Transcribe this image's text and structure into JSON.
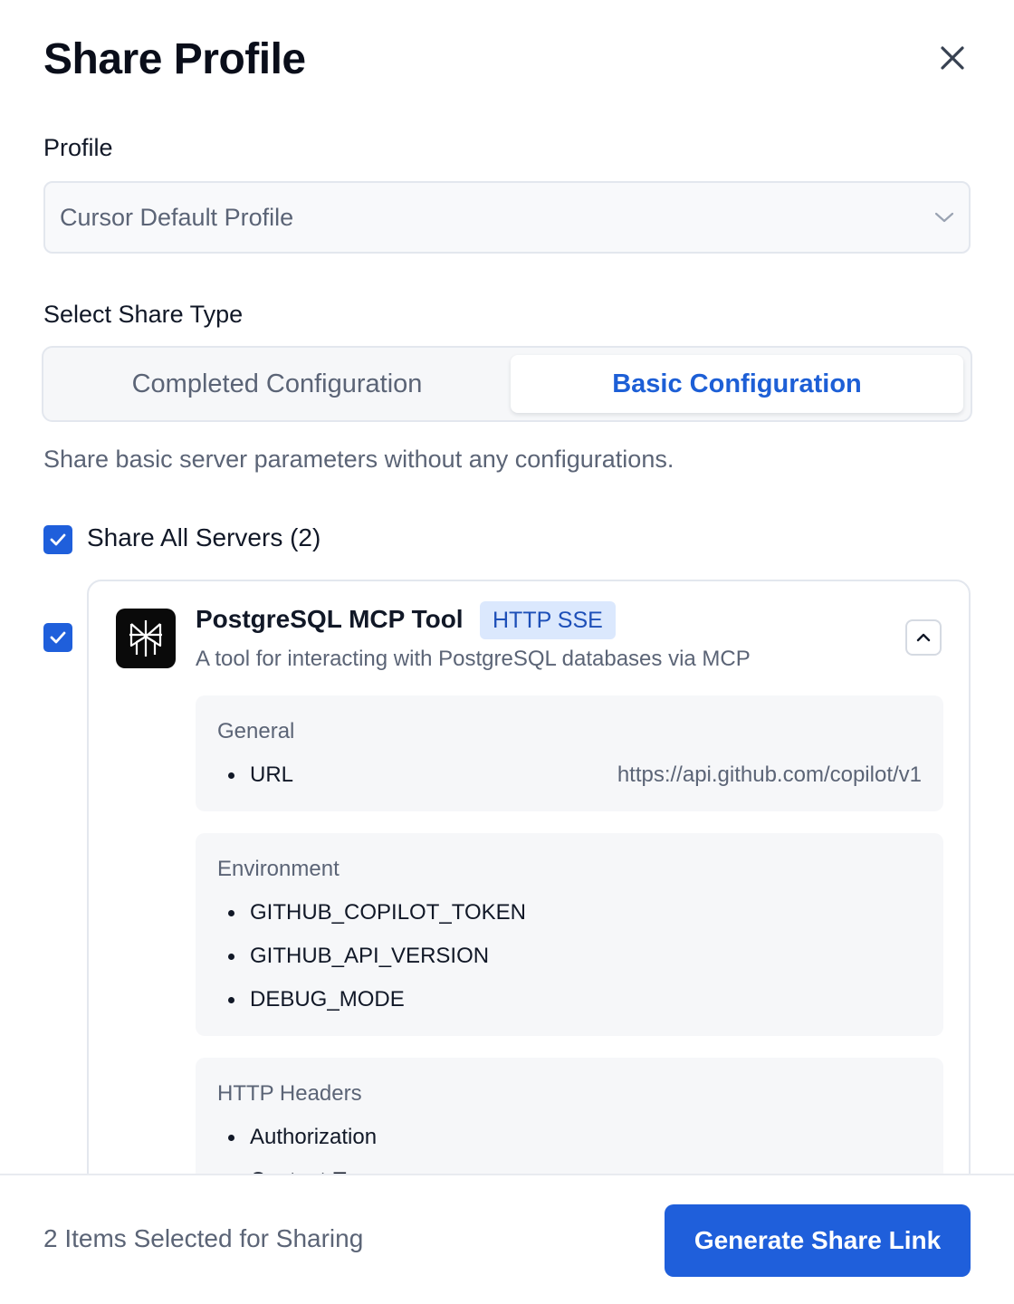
{
  "dialog": {
    "title": "Share Profile",
    "close_icon": "close-icon"
  },
  "profile": {
    "label": "Profile",
    "selected": "Cursor Default Profile",
    "dropdown_icon": "chevron-down-icon"
  },
  "share_type": {
    "label": "Select Share Type",
    "options": [
      "Completed Configuration",
      "Basic Configuration"
    ],
    "selected": "Basic Configuration",
    "description": "Share basic server parameters without any configurations."
  },
  "share_all": {
    "label": "Share All Servers (2)",
    "checked": true
  },
  "servers": [
    {
      "checked": true,
      "name": "PostgreSQL MCP Tool",
      "badge": "HTTP SSE",
      "description": "A tool for interacting with PostgreSQL databases via MCP",
      "expanded": true,
      "sections": {
        "general": {
          "title": "General",
          "items": [
            {
              "key": "URL",
              "value": "https://api.github.com/copilot/v1"
            }
          ]
        },
        "environment": {
          "title": "Environment",
          "items": [
            "GITHUB_COPILOT_TOKEN",
            "GITHUB_API_VERSION",
            "DEBUG_MODE"
          ]
        },
        "http_headers": {
          "title": "HTTP Headers",
          "items": [
            "Authorization",
            "Content-Type"
          ]
        }
      }
    }
  ],
  "footer": {
    "selected_text": "2 Items Selected for Sharing",
    "generate_label": "Generate Share Link"
  },
  "colors": {
    "accent": "#1f5fdb",
    "badge_bg": "#dbe8fd",
    "muted_text": "#5b6476",
    "section_bg": "#f6f7f9"
  }
}
